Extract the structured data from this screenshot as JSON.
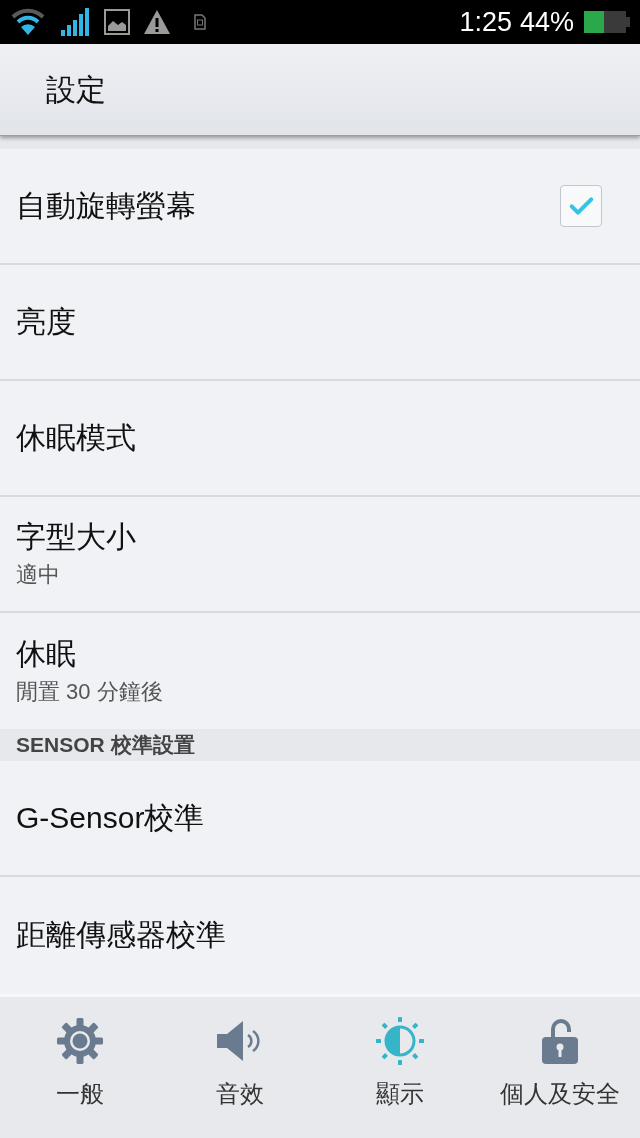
{
  "status_bar": {
    "time": "1:25",
    "battery": "44%"
  },
  "app_bar": {
    "title": "設定"
  },
  "items": [
    {
      "kind": "checkbox",
      "title": "自動旋轉螢幕",
      "checked": true
    },
    {
      "kind": "plain",
      "title": "亮度"
    },
    {
      "kind": "plain",
      "title": "休眠模式"
    },
    {
      "kind": "summary",
      "title": "字型大小",
      "summary": "適中"
    },
    {
      "kind": "summary",
      "title": "休眠",
      "summary": "閒置 30 分鐘後"
    },
    {
      "kind": "header",
      "title": "SENSOR 校準設置"
    },
    {
      "kind": "plain",
      "title": "G-Sensor校準"
    },
    {
      "kind": "plain",
      "title": "距離傳感器校準"
    }
  ],
  "tabs": [
    {
      "label": "一般",
      "selected": false
    },
    {
      "label": "音效",
      "selected": false
    },
    {
      "label": "顯示",
      "selected": true
    },
    {
      "label": "個人及安全",
      "selected": false
    }
  ]
}
